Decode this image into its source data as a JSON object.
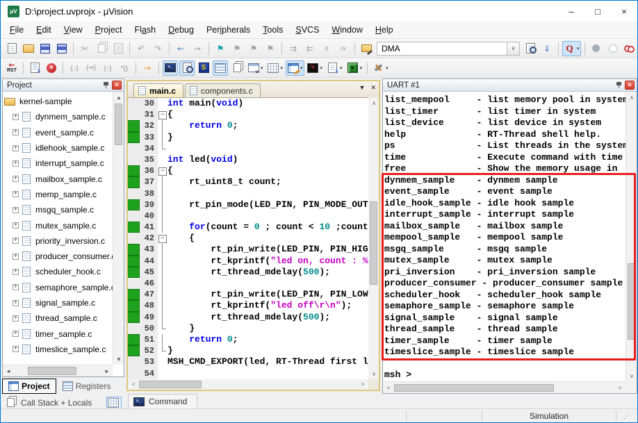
{
  "theme": {
    "accent": "#0076d7",
    "green": "#1ea21e",
    "kw": "#0000e8",
    "num": "#008b8b",
    "str": "#c400c4"
  },
  "window": {
    "title": "D:\\project.uvprojx - μVision",
    "icon_label": "μV",
    "minimize": "–",
    "maximize": "□",
    "close": "×"
  },
  "menu": {
    "items": [
      {
        "label": "File",
        "u": 0
      },
      {
        "label": "Edit",
        "u": 0
      },
      {
        "label": "View",
        "u": 0
      },
      {
        "label": "Project",
        "u": 0
      },
      {
        "label": "Flash",
        "u": 2
      },
      {
        "label": "Debug",
        "u": 0
      },
      {
        "label": "Peripherals",
        "u": 3
      },
      {
        "label": "Tools",
        "u": 0
      },
      {
        "label": "SVCS",
        "u": 0
      },
      {
        "label": "Window",
        "u": 0
      },
      {
        "label": "Help",
        "u": 0
      }
    ]
  },
  "toolbar1": {
    "combo_value": "DMA",
    "items": [
      {
        "name": "new-file-icon",
        "kind": "page"
      },
      {
        "name": "open-folder-icon",
        "kind": "folder"
      },
      {
        "name": "save-icon",
        "kind": "floppy"
      },
      {
        "name": "save-all-icon",
        "kind": "floppy2"
      },
      {
        "sep": true
      },
      {
        "name": "cut-icon",
        "kind": "glyph",
        "glyph": "✂",
        "dim": true
      },
      {
        "name": "copy-icon",
        "kind": "pages",
        "dim": true
      },
      {
        "name": "paste-icon",
        "kind": "clipboard",
        "dim": true
      },
      {
        "sep": true
      },
      {
        "name": "undo-icon",
        "kind": "glyph",
        "glyph": "↶",
        "dim": true
      },
      {
        "name": "redo-icon",
        "kind": "glyph",
        "glyph": "↷",
        "dim": true
      },
      {
        "sep": true
      },
      {
        "name": "navigate-back-icon",
        "kind": "glyph",
        "glyph": "←",
        "color": "#4f81c2"
      },
      {
        "name": "navigate-forward-icon",
        "kind": "glyph",
        "glyph": "→",
        "dim": true
      },
      {
        "sep": true
      },
      {
        "name": "bookmark-icon",
        "kind": "glyph",
        "glyph": "⚑",
        "color": "#1d9fae"
      },
      {
        "name": "bookmark-prev-icon",
        "kind": "glyph",
        "glyph": "⚑",
        "dim": true
      },
      {
        "name": "bookmark-next-icon",
        "kind": "glyph",
        "glyph": "⚑",
        "dim": true
      },
      {
        "name": "bookmark-clear-icon",
        "kind": "glyph",
        "glyph": "⚑",
        "dim": true
      },
      {
        "sep": true
      },
      {
        "name": "indent-icon",
        "kind": "glyph",
        "glyph": "⇉",
        "dim": true
      },
      {
        "name": "unindent-icon",
        "kind": "glyph",
        "glyph": "⇇",
        "dim": true
      },
      {
        "name": "comment-icon",
        "kind": "txt",
        "text": "//",
        "dim": true
      },
      {
        "name": "uncomment-icon",
        "kind": "txt",
        "text": "/×",
        "dim": true
      },
      {
        "sep": true
      },
      {
        "name": "flash-config-icon",
        "kind": "folderpen"
      },
      {
        "combo": true,
        "name": "flash-target-combo"
      },
      {
        "name": "find-in-files-icon",
        "kind": "pagefind2"
      },
      {
        "name": "incremental-find-icon",
        "kind": "glyph",
        "glyph": "⇓",
        "color": "#3a6fd0"
      },
      {
        "sep": true
      },
      {
        "name": "find-icon",
        "kind": "qsearch",
        "hl": true,
        "caret": true
      },
      {
        "sep": true
      },
      {
        "name": "insert-breakpoint-icon",
        "kind": "circle-gray"
      },
      {
        "name": "enable-breakpoint-icon",
        "kind": "circle-hollow"
      },
      {
        "name": "disable-all-breakpoints-icon",
        "kind": "donut2"
      },
      {
        "name": "kill-all-breakpoints-icon",
        "kind": "donutx"
      },
      {
        "sep": true
      },
      {
        "spacer": true
      },
      {
        "name": "project-window-icon",
        "kind": "winlist",
        "hl": true
      }
    ]
  },
  "toolbar2": {
    "items": [
      {
        "name": "reset-icon",
        "kind": "rst"
      },
      {
        "sep": true
      },
      {
        "name": "run-icon",
        "kind": "runlist"
      },
      {
        "name": "stop-icon",
        "kind": "stopx"
      },
      {
        "sep": true
      },
      {
        "name": "step-icon",
        "kind": "txt",
        "text": "{↓}",
        "dim": true
      },
      {
        "name": "step-over-icon",
        "kind": "txt",
        "text": "{⇒}",
        "dim": true
      },
      {
        "name": "step-out-icon",
        "kind": "txt",
        "text": "{↑}",
        "dim": true
      },
      {
        "name": "run-to-cursor-icon",
        "kind": "txt",
        "text": "*{}",
        "dim": true
      },
      {
        "sep": true
      },
      {
        "name": "show-next-statement-icon",
        "kind": "glyph",
        "glyph": "→",
        "color": "#e8a020"
      },
      {
        "sep": true
      },
      {
        "name": "command-window-icon",
        "kind": "term",
        "hl": true
      },
      {
        "name": "disassembly-window-icon",
        "kind": "pagefind",
        "hl": true
      },
      {
        "name": "symbol-window-icon",
        "kind": "sbox"
      },
      {
        "name": "registers-window-icon",
        "kind": "gridlines",
        "hl": true
      },
      {
        "name": "call-stack-window-icon",
        "kind": "pages"
      },
      {
        "name": "watch-window-icon",
        "kind": "watch",
        "caret": true
      },
      {
        "name": "memory-window-icon",
        "kind": "grid",
        "caret": true
      },
      {
        "name": "serial-window-icon",
        "kind": "winpen",
        "hl": true,
        "caret": true
      },
      {
        "name": "analysis-window-icon",
        "kind": "wave",
        "caret": true
      },
      {
        "name": "trace-window-icon",
        "kind": "pagedown",
        "caret": true
      },
      {
        "name": "system-viewer-icon",
        "kind": "chip",
        "caret": true
      },
      {
        "sep": true
      },
      {
        "name": "toolbox-icon",
        "kind": "tools",
        "caret": true
      }
    ]
  },
  "project_panel": {
    "title": "Project",
    "root": "kernel-sample",
    "files": [
      "dynmem_sample.c",
      "event_sample.c",
      "idlehook_sample.c",
      "interrupt_sample.c",
      "mailbox_sample.c",
      "memp_sample.c",
      "msgq_sample.c",
      "mutex_sample.c",
      "priority_inversion.c",
      "producer_consumer.c",
      "scheduler_hook.c",
      "semaphore_sample.c",
      "signal_sample.c",
      "thread_sample.c",
      "timer_sample.c",
      "timeslice_sample.c"
    ]
  },
  "editor": {
    "tabs": [
      {
        "label": "main.c",
        "active": true
      },
      {
        "label": "components.c",
        "active": false
      }
    ],
    "lines": [
      {
        "n": 30,
        "fold": "",
        "segs": [
          {
            "t": "int",
            "c": "k"
          },
          {
            "t": " main("
          },
          {
            "t": "void",
            "c": "k"
          },
          {
            "t": ")"
          }
        ]
      },
      {
        "n": 31,
        "fold": "b",
        "segs": [
          {
            "t": "{"
          }
        ]
      },
      {
        "n": 32,
        "g": true,
        "fold": "v",
        "segs": [
          {
            "t": "    "
          },
          {
            "t": "return",
            "c": "k"
          },
          {
            "t": " "
          },
          {
            "t": "0",
            "c": "n"
          },
          {
            "t": ";"
          }
        ]
      },
      {
        "n": 33,
        "g": true,
        "fold": "v",
        "segs": [
          {
            "t": "}"
          }
        ]
      },
      {
        "n": 34,
        "fold": "e",
        "segs": []
      },
      {
        "n": 35,
        "fold": "",
        "segs": [
          {
            "t": "int",
            "c": "k"
          },
          {
            "t": " led("
          },
          {
            "t": "void",
            "c": "k"
          },
          {
            "t": ")"
          }
        ]
      },
      {
        "n": 36,
        "g": true,
        "fold": "b",
        "segs": [
          {
            "t": "{"
          }
        ]
      },
      {
        "n": 37,
        "g": true,
        "fold": "v",
        "segs": [
          {
            "t": "    rt_uint8_t count;"
          }
        ]
      },
      {
        "n": 38,
        "fold": "v",
        "segs": []
      },
      {
        "n": 39,
        "g": true,
        "fold": "v",
        "segs": [
          {
            "t": "    rt_pin_mode(LED_PIN, PIN_MODE_OUTPUT);"
          }
        ]
      },
      {
        "n": 40,
        "fold": "v",
        "segs": []
      },
      {
        "n": 41,
        "g": true,
        "fold": "v",
        "segs": [
          {
            "t": "    "
          },
          {
            "t": "for",
            "c": "k"
          },
          {
            "t": "(count = "
          },
          {
            "t": "0",
            "c": "n"
          },
          {
            "t": " ; count < "
          },
          {
            "t": "10",
            "c": "n"
          },
          {
            "t": " ;count++)"
          }
        ]
      },
      {
        "n": 42,
        "fold": "b",
        "segs": [
          {
            "t": "    {"
          }
        ]
      },
      {
        "n": 43,
        "g": true,
        "fold": "v",
        "segs": [
          {
            "t": "        rt_pin_write(LED_PIN, PIN_HIGH);"
          }
        ]
      },
      {
        "n": 44,
        "g": true,
        "fold": "v",
        "segs": [
          {
            "t": "        rt_kprintf("
          },
          {
            "t": "\"led on, count : %d\\r\\n\"",
            "c": "s"
          },
          {
            "t": ", count);"
          }
        ]
      },
      {
        "n": 45,
        "g": true,
        "fold": "v",
        "segs": [
          {
            "t": "        rt_thread_mdelay("
          },
          {
            "t": "500",
            "c": "n"
          },
          {
            "t": ");"
          }
        ]
      },
      {
        "n": 46,
        "fold": "v",
        "segs": []
      },
      {
        "n": 47,
        "g": true,
        "fold": "v",
        "segs": [
          {
            "t": "        rt_pin_write(LED_PIN, PIN_LOW);"
          }
        ]
      },
      {
        "n": 48,
        "g": true,
        "fold": "v",
        "segs": [
          {
            "t": "        rt_kprintf("
          },
          {
            "t": "\"led off\\r\\n\"",
            "c": "s"
          },
          {
            "t": ");"
          }
        ]
      },
      {
        "n": 49,
        "g": true,
        "fold": "v",
        "segs": [
          {
            "t": "        rt_thread_mdelay("
          },
          {
            "t": "500",
            "c": "n"
          },
          {
            "t": ");"
          }
        ]
      },
      {
        "n": 50,
        "fold": "e",
        "segs": [
          {
            "t": "    }"
          }
        ]
      },
      {
        "n": 51,
        "g": true,
        "fold": "v",
        "segs": [
          {
            "t": "    "
          },
          {
            "t": "return",
            "c": "k"
          },
          {
            "t": " "
          },
          {
            "t": "0",
            "c": "n"
          },
          {
            "t": ";"
          }
        ]
      },
      {
        "n": 52,
        "g": true,
        "fold": "e",
        "segs": [
          {
            "t": "}"
          }
        ]
      },
      {
        "n": 53,
        "fold": "",
        "segs": [
          {
            "t": "MSH_CMD_EXPORT(led, RT-Thread first led sample);"
          }
        ]
      },
      {
        "n": 54,
        "fold": "",
        "segs": []
      }
    ]
  },
  "uart": {
    "title": "UART #1",
    "lines": [
      "list_mempool     - list memory pool in system",
      "list_timer       - list timer in system",
      "list_device      - list device in system",
      "help             - RT-Thread shell help.",
      "ps               - List threads in the system",
      "time             - Execute command with time",
      "free             - Show the memory usage in",
      "dynmem_sample    - dynmem sample",
      "event_sample     - event sample",
      "idle_hook_sample - idle hook sample",
      "interrupt_sample - interrupt sample",
      "mailbox_sample   - mailbox sample",
      "mempool_sample   - mempool sample",
      "msgq_sample      - msgq sample",
      "mutex_sample     - mutex sample",
      "pri_inversion    - pri_inversion sample",
      "producer_consumer - producer_consumer sample",
      "scheduler_hook   - scheduler_hook sample",
      "semaphore_sample - semaphore sample",
      "signal_sample    - signal sample",
      "thread_sample    - thread sample",
      "timer_sample     - timer sample",
      "timeslice_sample - timeslice sample",
      "",
      "msh >"
    ]
  },
  "bottom": {
    "project_tab": "Project",
    "registers_tab": "Registers",
    "callstack_label": "Call Stack + Locals",
    "command_tab": "Command"
  },
  "statusbar": {
    "text": "Simulation"
  }
}
